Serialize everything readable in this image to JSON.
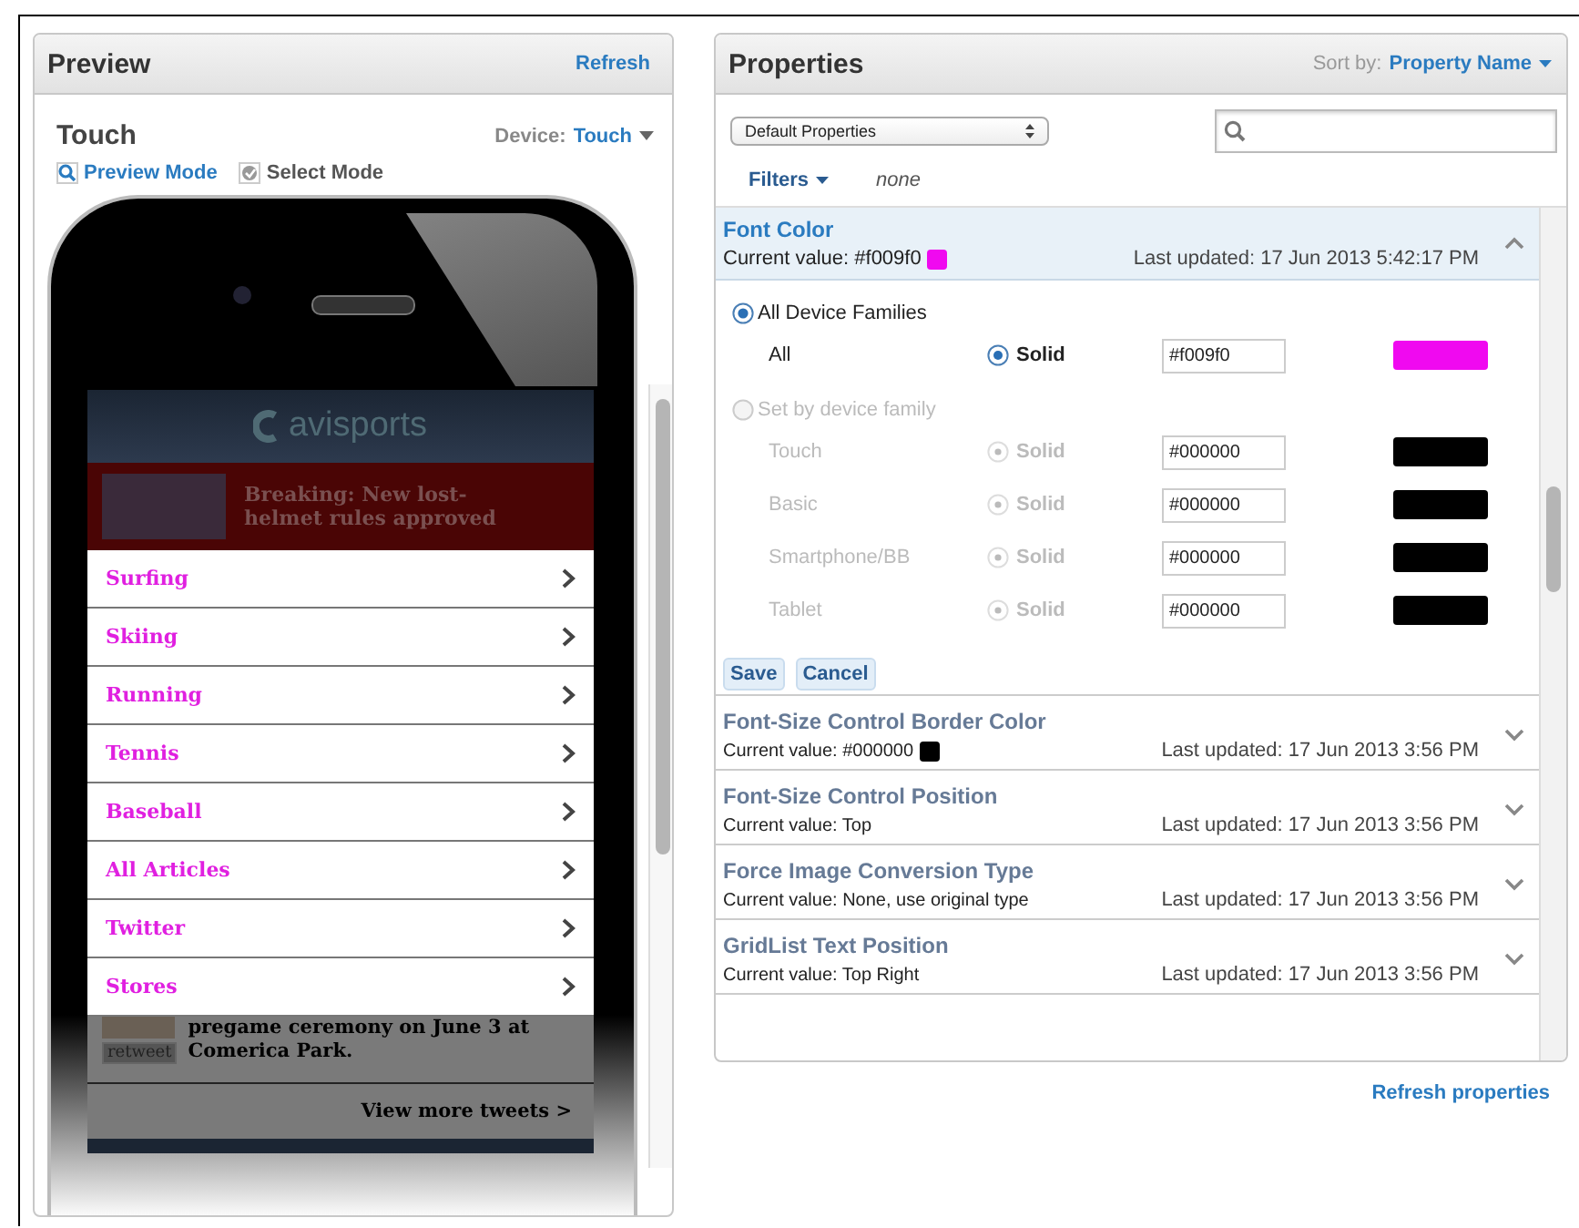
{
  "preview": {
    "title": "Preview",
    "refresh": "Refresh",
    "device_name": "Touch",
    "device_label": "Device:",
    "device_value": "Touch",
    "modes": [
      {
        "label": "Preview Mode",
        "selected": true
      },
      {
        "label": "Select Mode",
        "selected": false
      }
    ],
    "phone": {
      "logo": "avisports",
      "breaking": "Breaking: New lost-helmet rules approved",
      "menu": [
        "Surfing",
        "Skiing",
        "Running",
        "Tennis",
        "Baseball",
        "All Articles",
        "Twitter",
        "Stores"
      ],
      "tweet": "pregame ceremony on June 3 at Comerica Park.",
      "retweet": "retweet",
      "view_more": "View more tweets >"
    }
  },
  "properties": {
    "title": "Properties",
    "sort_label": "Sort by:",
    "sort_value": "Property Name",
    "preset": "Default Properties",
    "filters": "Filters",
    "filters_value": "none",
    "expanded": {
      "name": "Font Color",
      "current": "Current value: #f009f0",
      "color": "#f009f0",
      "updated": "Last updated: 17 Jun 2013 5:42:17 PM",
      "groups": [
        {
          "label": "All Device Families",
          "selected": true,
          "rows": [
            {
              "name": "All",
              "style": "Solid",
              "style_selected": true,
              "value": "#f009f0",
              "color": "#f009f0"
            }
          ]
        },
        {
          "label": "Set by device family",
          "selected": false,
          "rows": [
            {
              "name": "Touch",
              "style": "Solid",
              "style_selected": true,
              "value": "#000000",
              "color": "#000000"
            },
            {
              "name": "Basic",
              "style": "Solid",
              "style_selected": true,
              "value": "#000000",
              "color": "#000000"
            },
            {
              "name": "Smartphone/BB",
              "style": "Solid",
              "style_selected": true,
              "value": "#000000",
              "color": "#000000"
            },
            {
              "name": "Tablet",
              "style": "Solid",
              "style_selected": true,
              "value": "#000000",
              "color": "#000000"
            }
          ]
        }
      ],
      "buttons": [
        "Save",
        "Cancel"
      ]
    },
    "collapsed": [
      {
        "name": "Font-Size Control Border Color",
        "current": "Current value: #000000",
        "color": "#000000",
        "updated": "Last updated: 17 Jun 2013 3:56 PM"
      },
      {
        "name": "Font-Size Control Position",
        "current": "Current value: Top",
        "updated": "Last updated: 17 Jun 2013 3:56 PM"
      },
      {
        "name": "Force Image Conversion Type",
        "current": "Current value: None, use original type",
        "updated": "Last updated: 17 Jun 2013 3:56 PM"
      },
      {
        "name": "GridList Text Position",
        "current": "Current value: Top Right",
        "updated": "Last updated: 17 Jun 2013 3:56 PM"
      }
    ],
    "refresh": "Refresh properties"
  }
}
